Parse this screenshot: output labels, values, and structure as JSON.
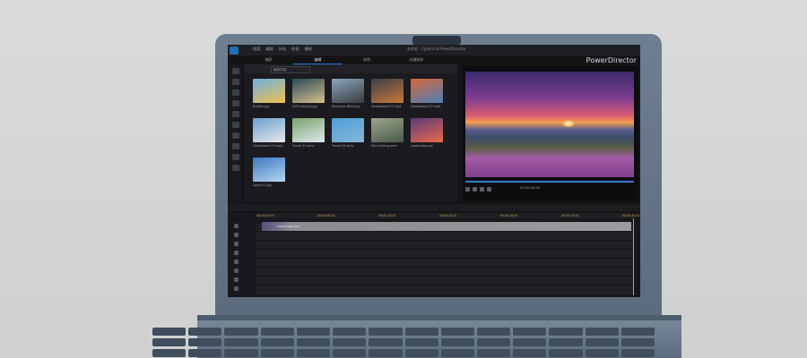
{
  "app": {
    "brand": "PowerDirector",
    "window_title": "未命名 - CyberLink PowerDirector",
    "menu": [
      "档案",
      "编辑",
      "外挂",
      "检视",
      "播放"
    ],
    "tabs": [
      "捕获",
      "编辑",
      "制作",
      "光碟制作"
    ],
    "active_tab_index": 1
  },
  "library": {
    "dropdown_label": "媒体内容",
    "thumbnails": [
      {
        "caption": "Bubble.jpg",
        "colors": [
          "#6fb0e0",
          "#f0c14c"
        ]
      },
      {
        "caption": "Cliff Jumping.jpg",
        "colors": [
          "#2b4a5a",
          "#d6c08a"
        ]
      },
      {
        "caption": "Mountain Biker.jpg",
        "colors": [
          "#8aa6c0",
          "#3b3b3b"
        ]
      },
      {
        "caption": "Skateboard 01.mp4",
        "colors": [
          "#3a3f4a",
          "#c8783a"
        ]
      },
      {
        "caption": "Skateboard 02.mp4",
        "colors": [
          "#d9663a",
          "#4a80b8"
        ]
      },
      {
        "caption": "Skateboard 03.mp4",
        "colors": [
          "#6aa0d0",
          "#e8e8e8"
        ]
      },
      {
        "caption": "Travel 01.wmv",
        "colors": [
          "#7aa36a",
          "#dfe8ef"
        ]
      },
      {
        "caption": "Travel 02.wmv",
        "colors": [
          "#4d9fd6",
          "#86b7d9"
        ]
      },
      {
        "caption": "Kite Surfing.wmv",
        "colors": [
          "#9aa58c",
          "#4a5a4a"
        ]
      },
      {
        "caption": "Landscape.jpg",
        "colors": [
          "#5b3a7a",
          "#e86a4a"
        ]
      },
      {
        "caption": "Sport 01.jpg",
        "colors": [
          "#3a78c0",
          "#b9d6ef"
        ]
      }
    ]
  },
  "preview": {
    "timecode": "00;00;00;00"
  },
  "timeline": {
    "ruler_ticks": [
      "00;00;00;00",
      "00;00;06;20",
      "00;00;13;10",
      "00;00;20;00",
      "00;00;26;20",
      "00;00;33;10",
      "00;00;40;00"
    ],
    "clip_label": "Landscape.jpg"
  }
}
